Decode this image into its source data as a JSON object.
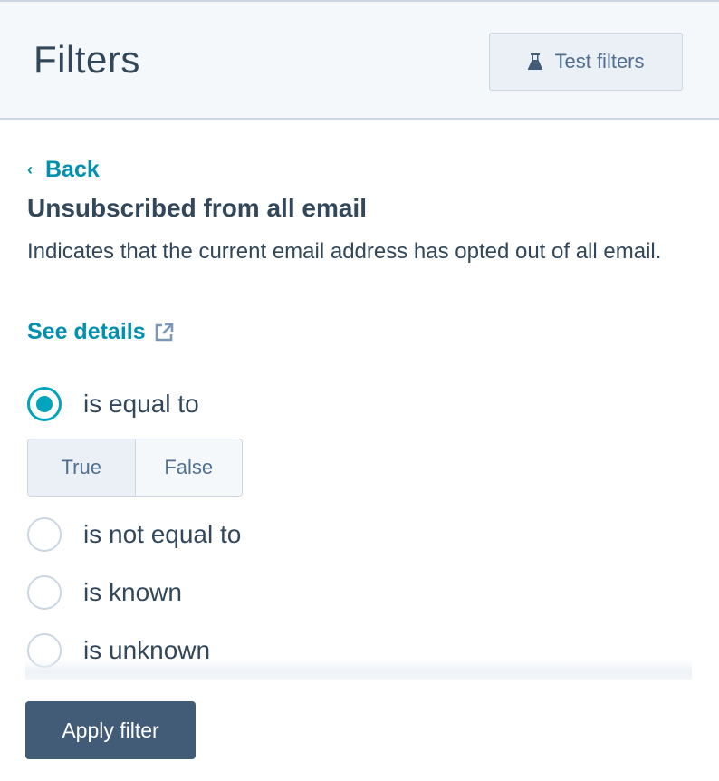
{
  "header": {
    "title": "Filters",
    "test_button": {
      "label": "Test filters",
      "icon": "flask-icon"
    }
  },
  "panel": {
    "back_label": "Back",
    "property_title": "Unsubscribed from all email",
    "property_description": "Indicates that the current email address has opted out of all email.",
    "see_details_label": "See details",
    "operators": [
      {
        "label": "is equal to",
        "checked": true
      },
      {
        "label": "is not equal to",
        "checked": false
      },
      {
        "label": "is known",
        "checked": false
      },
      {
        "label": "is unknown",
        "checked": false
      }
    ],
    "value_toggle": {
      "options": [
        "True",
        "False"
      ],
      "selected": "True"
    }
  },
  "footer": {
    "apply_label": "Apply filter"
  },
  "colors": {
    "accent": "#00a4bd",
    "link": "#0091ae",
    "primary_button": "#425b76",
    "text": "#33475b"
  }
}
